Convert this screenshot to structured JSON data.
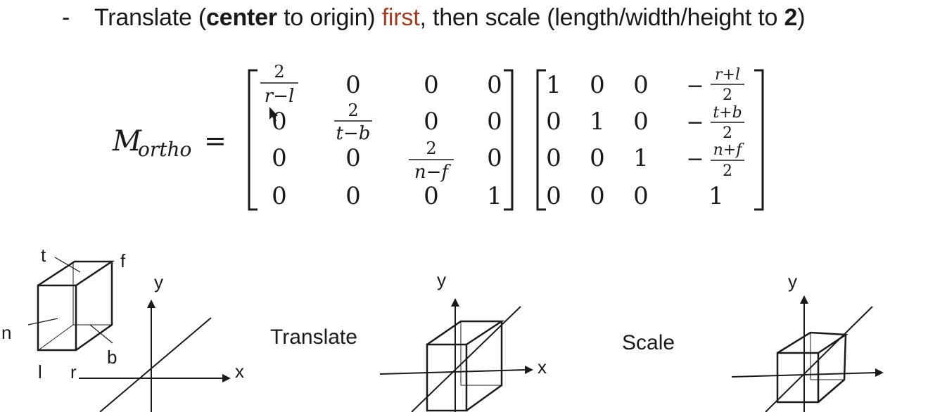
{
  "bullet": {
    "dash": "-",
    "part1": "Translate (",
    "bold1": "center",
    "part2": " to origin) ",
    "highlight": "first",
    "part3": ", then scale (length/width/height to ",
    "bold2": "2",
    "part4": ")"
  },
  "colors": {
    "highlight": "#a23b1f",
    "text": "#1a1a1a"
  },
  "equation": {
    "lhs_symbol": "M",
    "lhs_subscript": "ortho",
    "equals": "=",
    "scale_matrix": [
      [
        "2",
        "r−l",
        "0",
        "0",
        "0"
      ],
      [
        "0",
        "2",
        "t−b",
        "0",
        "0"
      ],
      [
        "0",
        "0",
        "2",
        "n−f",
        "0"
      ],
      [
        "0",
        "0",
        "0",
        "1"
      ]
    ],
    "scale_cells": {
      "r0": {
        "num": "2",
        "den": "r−l",
        "c1": "0",
        "c2": "0",
        "c3": "0"
      },
      "r1": {
        "c0": "0",
        "num": "2",
        "den": "t−b",
        "c2": "0",
        "c3": "0"
      },
      "r2": {
        "c0": "0",
        "c1": "0",
        "num": "2",
        "den": "n−f",
        "c3": "0"
      },
      "r3": {
        "c0": "0",
        "c1": "0",
        "c2": "0",
        "c3": "1"
      }
    },
    "translate_cells": {
      "r0": {
        "c0": "1",
        "c1": "0",
        "c2": "0",
        "minus": "−",
        "num": "r+l",
        "den": "2"
      },
      "r1": {
        "c0": "0",
        "c1": "1",
        "c2": "0",
        "minus": "−",
        "num": "t+b",
        "den": "2"
      },
      "r2": {
        "c0": "0",
        "c1": "0",
        "c2": "1",
        "minus": "−",
        "num": "n+f",
        "den": "2"
      },
      "r3": {
        "c0": "0",
        "c1": "0",
        "c2": "0",
        "c3": "1"
      }
    }
  },
  "diagrams": {
    "box_labels": {
      "t": "t",
      "f": "f",
      "n": "n",
      "b": "b",
      "l": "l",
      "r": "r"
    },
    "axis1": {
      "y": "y",
      "x": "x"
    },
    "translate_label": "Translate",
    "axis2": {
      "y": "y",
      "x": "x"
    },
    "scale_label": "Scale",
    "axis3": {
      "y": "y"
    }
  }
}
